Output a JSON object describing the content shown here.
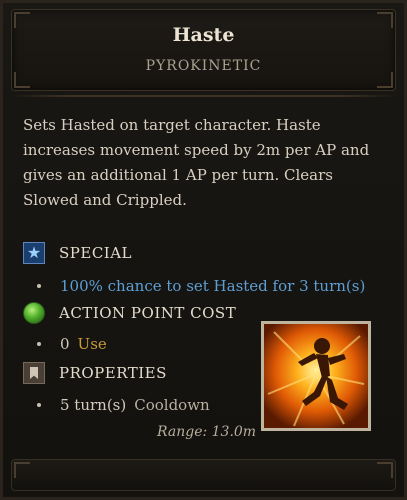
{
  "spell": {
    "name": "Haste",
    "school": "PYROKINETIC",
    "description": "Sets Hasted on target character. Haste increases movement speed by 2m per AP and gives an additional 1 AP per turn. Clears Slowed and Crippled.",
    "icon": "running-figure-fire-icon"
  },
  "special": {
    "label": "SPECIAL",
    "icon": "star-icon",
    "line": "100% chance to set Hasted for 3 turn(s)"
  },
  "ap_cost": {
    "label": "ACTION POINT COST",
    "icon": "green-orb-icon",
    "value": "0",
    "unit": "Use"
  },
  "properties": {
    "label": "PROPERTIES",
    "icon": "bookmark-icon",
    "value": "5 turn(s)",
    "unit": "Cooldown"
  },
  "range": "Range: 13.0m",
  "colors": {
    "special_text": "#5f9fd3",
    "ap_unit": "#c89a3a",
    "background": "#15130f"
  }
}
